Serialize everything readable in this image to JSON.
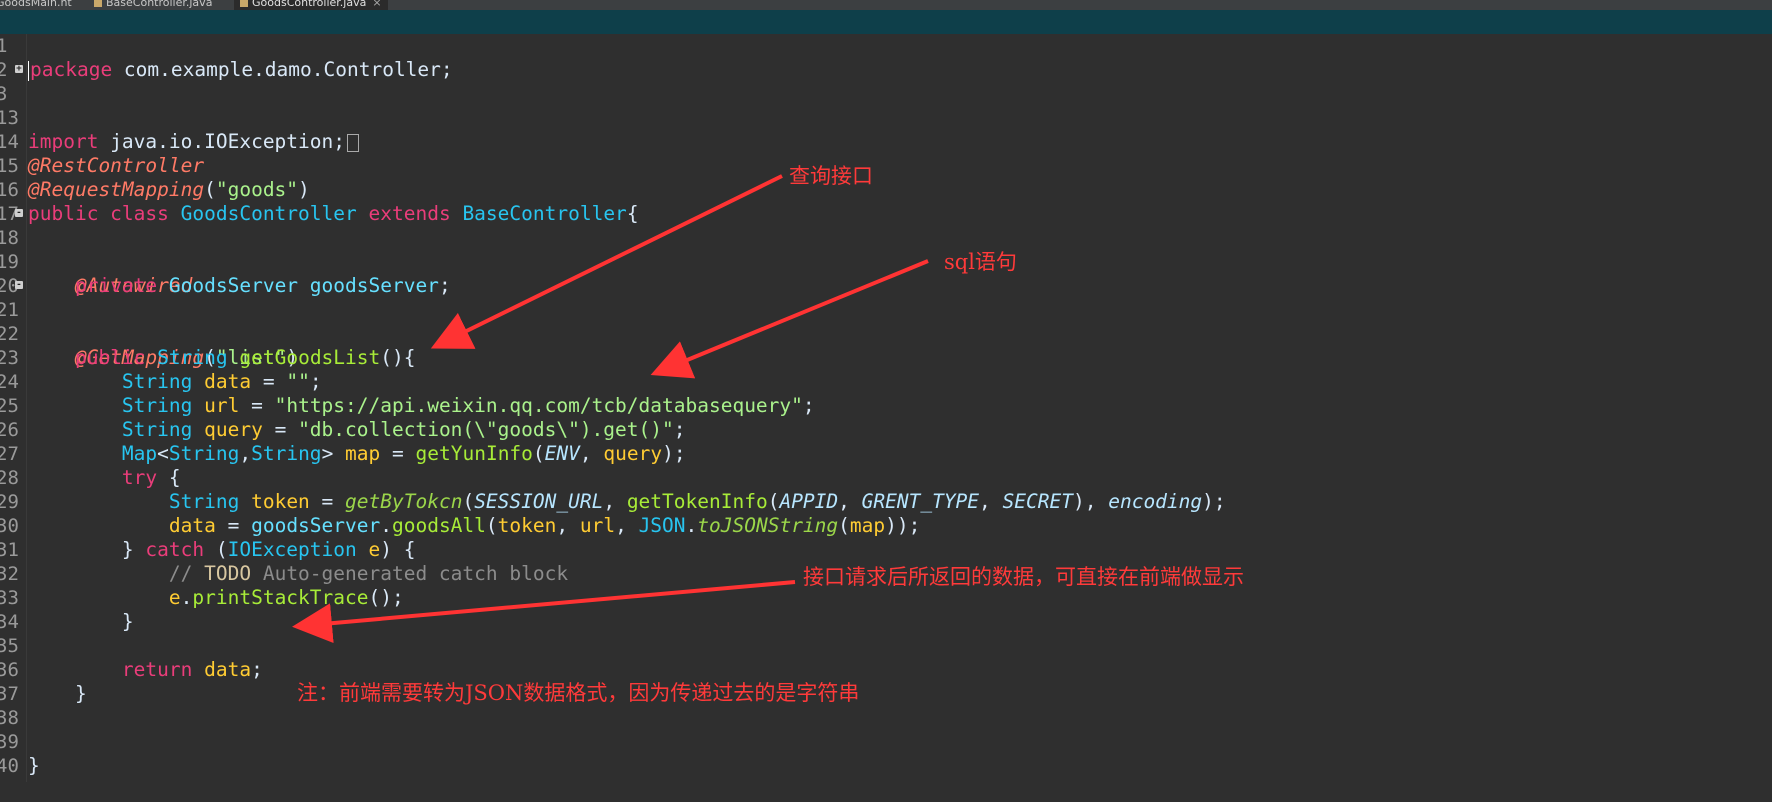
{
  "tabs": [
    {
      "label": "GoodsMain.ht"
    },
    {
      "label": "BaseController.java"
    },
    {
      "label": "GoodsController.java",
      "close": "×"
    }
  ],
  "code_lines": [
    {
      "num": "1",
      "text": "package com.example.damo.Controller;"
    },
    {
      "num": "2",
      "text": ""
    },
    {
      "num": "3",
      "text": "import java.io.IOException;"
    },
    {
      "num": "13",
      "text": ""
    },
    {
      "num": "14",
      "text": "@RestController"
    },
    {
      "num": "15",
      "text": "@RequestMapping(\"goods\")"
    },
    {
      "num": "16",
      "text": "public class GoodsController extends BaseController{"
    },
    {
      "num": "17",
      "text": ""
    },
    {
      "num": "18",
      "text": "    @Autowired"
    },
    {
      "num": "19",
      "text": "    private GoodsServer goodsServer;"
    },
    {
      "num": "20",
      "text": ""
    },
    {
      "num": "21",
      "text": "    @GetMapping(\"list\")"
    },
    {
      "num": "22",
      "text": "    public String getGoodsList(){"
    },
    {
      "num": "23",
      "text": "        String data = \"\";"
    },
    {
      "num": "24",
      "text": "        String url = \"https://api.weixin.qq.com/tcb/databasequery\";"
    },
    {
      "num": "25",
      "text": "        String query = \"db.collection(\\\"goods\\\").get()\";"
    },
    {
      "num": "26",
      "text": "        Map<String,String> map = getYunInfo(ENV, query);"
    },
    {
      "num": "27",
      "text": "        try {"
    },
    {
      "num": "28",
      "text": "            String token = getByTokcn(SESSION_URL, getTokenInfo(APPID, GRENT_TYPE, SECRET), encoding);"
    },
    {
      "num": "29",
      "text": "            data = goodsServer.goodsAll(token, url, JSON.toJSONString(map));"
    },
    {
      "num": "30",
      "text": "        } catch (IOException e) {"
    },
    {
      "num": "31",
      "text": "            // TODO Auto-generated catch block"
    },
    {
      "num": "32",
      "text": "            e.printStackTrace();"
    },
    {
      "num": "33",
      "text": "        }"
    },
    {
      "num": "34",
      "text": ""
    },
    {
      "num": "35",
      "text": "        return data;"
    },
    {
      "num": "36",
      "text": "    }"
    },
    {
      "num": "37",
      "text": ""
    },
    {
      "num": "38",
      "text": ""
    },
    {
      "num": "39",
      "text": "}"
    },
    {
      "num": "40",
      "text": ""
    }
  ],
  "annotations": {
    "query_api": "查询接口",
    "sql": "sql语句",
    "returned_data": "接口请求后所返回的数据，可直接在前端做显示",
    "note": "注：前端需要转为JSON数据格式，因为传递过去的是字符串"
  },
  "colors": {
    "background": "#2f2f2f",
    "current_line": "#0e3f4a",
    "keyword": "#ea3d7a",
    "type": "#28c5f0",
    "variable": "#ffcc33",
    "string": "#aaf28c",
    "annotation": "#ff7a66",
    "method": "#a8ec38",
    "comment": "#8c8c8c",
    "note_red": "#ff3a3a"
  }
}
